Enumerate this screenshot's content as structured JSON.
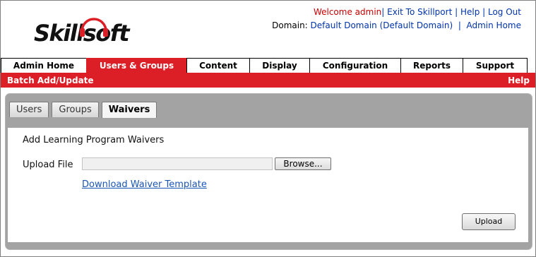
{
  "header": {
    "logo_text": "Skillsoft",
    "welcome": "Welcome admin",
    "exit_link": "Exit To Skillport",
    "help_link": "Help",
    "logout_link": "Log Out",
    "domain_label": "Domain:",
    "domain_link": "Default Domain (Default Domain)",
    "admin_home_link": "Admin Home"
  },
  "main_tabs": [
    {
      "label": "Admin Home",
      "active": false
    },
    {
      "label": "Users & Groups",
      "active": true
    },
    {
      "label": "Content",
      "active": false
    },
    {
      "label": "Display",
      "active": false
    },
    {
      "label": "Configuration",
      "active": false
    },
    {
      "label": "Reports",
      "active": false
    },
    {
      "label": "Support",
      "active": false
    }
  ],
  "redbar": {
    "title": "Batch Add/Update",
    "help": "Help"
  },
  "sub_tabs": [
    {
      "label": "Users",
      "active": false
    },
    {
      "label": "Groups",
      "active": false
    },
    {
      "label": "Waivers",
      "active": true
    }
  ],
  "form": {
    "heading": "Add Learning Program Waivers",
    "upload_label": "Upload File",
    "file_value": "",
    "browse_label": "Browse...",
    "download_link": "Download Waiver Template",
    "upload_button": "Upload"
  },
  "colors": {
    "brand_red": "#dc1f26",
    "link_blue": "#0033aa"
  }
}
